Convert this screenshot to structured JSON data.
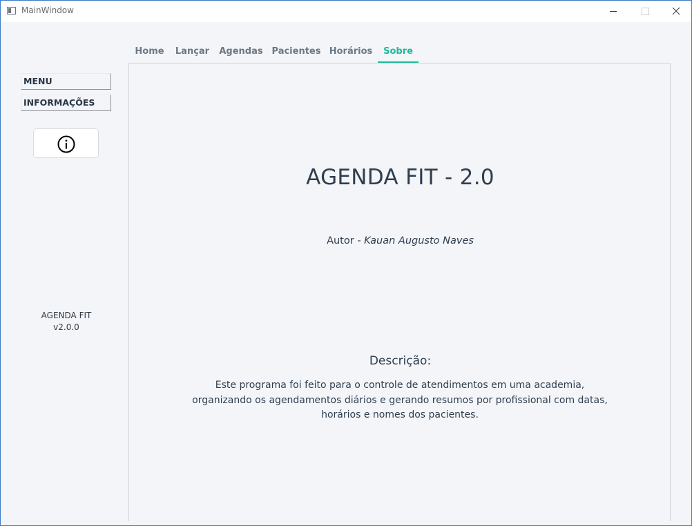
{
  "window": {
    "title": "MainWindow"
  },
  "tabs": [
    {
      "label": "Home",
      "active": false
    },
    {
      "label": "Lançar",
      "active": false
    },
    {
      "label": "Agendas",
      "active": false
    },
    {
      "label": "Pacientes",
      "active": false
    },
    {
      "label": "Horários",
      "active": false
    },
    {
      "label": "Sobre",
      "active": true
    }
  ],
  "sidebar": {
    "menu_label": "MENU",
    "info_label": "INFORMAÇÕES",
    "card_icon": "info-circle-icon",
    "app_name": "AGENDA FIT",
    "version": "v2.0.0"
  },
  "about": {
    "title": "AGENDA FIT - 2.0",
    "author_prefix": "Autor - ",
    "author_name": "Kauan Augusto Naves",
    "description_heading": "Descrição:",
    "description_lines": [
      "Este programa foi feito para o controle de atendimentos em uma academia,",
      "organizando os agendamentos diários e gerando resumos por profissional com datas,",
      "horários e nomes dos pacientes."
    ]
  },
  "colors": {
    "accent": "#1db99a",
    "background": "#f3f5f8",
    "text": "#2f3e4f",
    "tab_inactive": "#6d7887"
  }
}
